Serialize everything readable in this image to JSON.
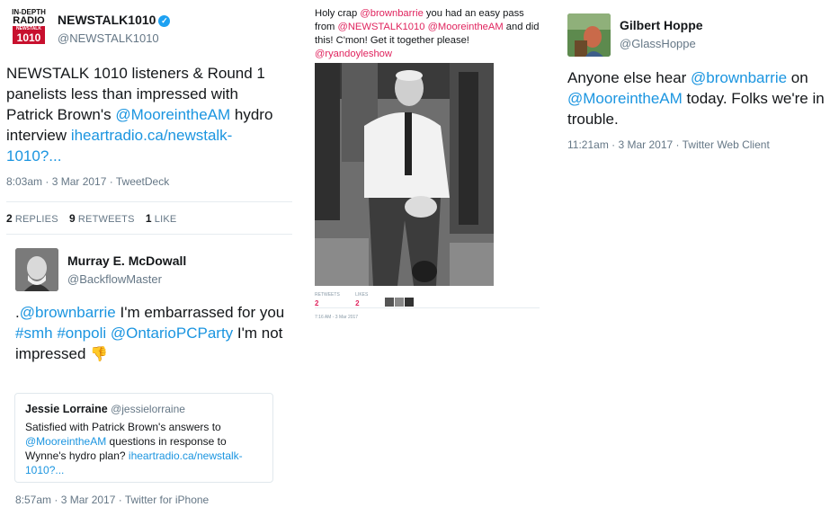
{
  "tweet1": {
    "logo_lines": [
      "IN-DEPTH",
      "RADIO",
      "NEWSTALK",
      "1010"
    ],
    "display_name": "NEWSTALK1010",
    "handle": "@NEWSTALK1010",
    "text_plain": "NEWSTALK 1010 listeners & Round 1 panelists less than impressed with Patrick Brown's ",
    "mention": "@MooreintheAM",
    "text_mid": " hydro interview ",
    "link": "iheartradio.ca/newstalk-1010?...",
    "time": "8:03am",
    "date": "3 Mar 2017",
    "client": "TweetDeck",
    "replies_count": "2",
    "replies_label": "REPLIES",
    "retweets_count": "9",
    "retweets_label": "RETWEETS",
    "likes_count": "1",
    "likes_label": "LIKE"
  },
  "tweet2": {
    "display_name": "Murray E. McDowall",
    "handle": "@BackflowMaster",
    "text_prefix": ".",
    "mention1": "@brownbarrie",
    "text_mid1": " I'm embarrassed for you ",
    "hashtag1": "#smh",
    "hashtag2": "#onpoli",
    "mention2": "@OntarioPCParty",
    "text_end": " I'm not impressed ",
    "emoji": "👎",
    "quote": {
      "name": "Jessie Lorraine",
      "handle": "@jessielorraine",
      "text1": "Satisfied with Patrick Brown's answers to ",
      "mention": "@MooreintheAM",
      "text2": " questions in response to Wynne's hydro plan? ",
      "link": "iheartradio.ca/newstalk-1010?..."
    },
    "time": "8:57am",
    "date": "3 Mar 2017",
    "client": "Twitter for iPhone"
  },
  "screenshot_tweet": {
    "t1": "Holy crap ",
    "m1": "@brownbarrie",
    "t2": " you had an easy pass from ",
    "m2": "@NEWSTALK1010",
    "t3": " ",
    "m3": "@MooreintheAM",
    "t4": " and did this! C'mon! Get it together please! ",
    "m4": "@ryandoyleshow",
    "retweets_label": "RETWEETS",
    "retweets_count": "2",
    "likes_label": "LIKES",
    "likes_count": "2",
    "timestamp": "7:16 AM - 3 Mar 2017"
  },
  "tweet3": {
    "display_name": "Gilbert Hoppe",
    "handle": "@GlassHoppe",
    "t1": "Anyone else hear ",
    "m1": "@brownbarrie",
    "t2": " on ",
    "m2": "@MooreintheAM",
    "t3": " today. Folks we're in trouble.",
    "time": "11:21am",
    "date": "3 Mar 2017",
    "client": "Twitter Web Client"
  },
  "colors": {
    "link": "#1b95e0",
    "mention_red": "#e0245e",
    "meta": "#657786"
  },
  "icons": [
    "verified-badge-icon",
    "thumbs-down-emoji"
  ]
}
